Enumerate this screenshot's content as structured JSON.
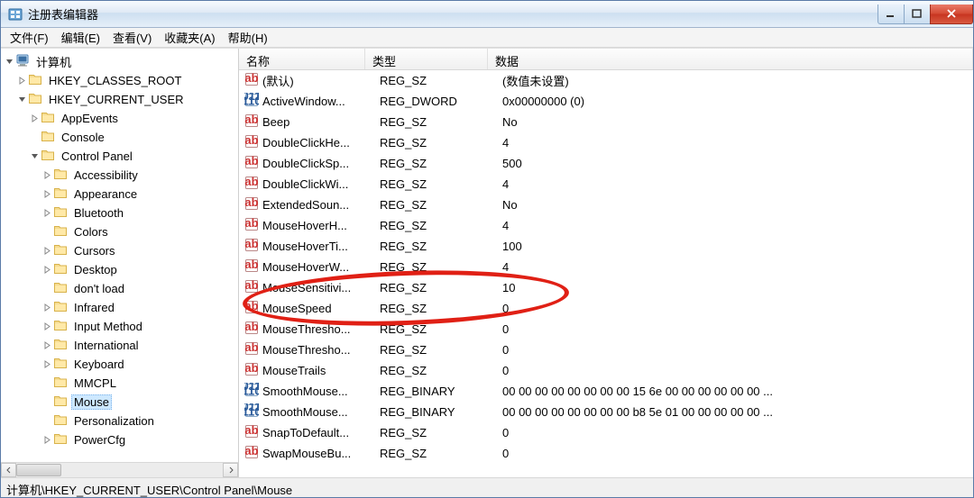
{
  "window": {
    "title": "注册表编辑器"
  },
  "menu": {
    "items": [
      "文件(F)",
      "编辑(E)",
      "查看(V)",
      "收藏夹(A)",
      "帮助(H)"
    ]
  },
  "tree": {
    "root": "计算机",
    "hkcr": "HKEY_CLASSES_ROOT",
    "hkcu": "HKEY_CURRENT_USER",
    "appevents": "AppEvents",
    "console": "Console",
    "controlpanel": "Control Panel",
    "cp_children": [
      "Accessibility",
      "Appearance",
      "Bluetooth",
      "Colors",
      "Cursors",
      "Desktop",
      "don't load",
      "Infrared",
      "Input Method",
      "International",
      "Keyboard",
      "MMCPL",
      "Mouse",
      "Personalization",
      "PowerCfg"
    ],
    "selected": "Mouse"
  },
  "columns": {
    "name": "名称",
    "type": "类型",
    "data": "数据"
  },
  "values": [
    {
      "icon": "sz",
      "name": "(默认)",
      "type": "REG_SZ",
      "data": "(数值未设置)"
    },
    {
      "icon": "bin",
      "name": "ActiveWindow...",
      "type": "REG_DWORD",
      "data": "0x00000000 (0)"
    },
    {
      "icon": "sz",
      "name": "Beep",
      "type": "REG_SZ",
      "data": "No"
    },
    {
      "icon": "sz",
      "name": "DoubleClickHe...",
      "type": "REG_SZ",
      "data": "4"
    },
    {
      "icon": "sz",
      "name": "DoubleClickSp...",
      "type": "REG_SZ",
      "data": "500"
    },
    {
      "icon": "sz",
      "name": "DoubleClickWi...",
      "type": "REG_SZ",
      "data": "4"
    },
    {
      "icon": "sz",
      "name": "ExtendedSoun...",
      "type": "REG_SZ",
      "data": "No"
    },
    {
      "icon": "sz",
      "name": "MouseHoverH...",
      "type": "REG_SZ",
      "data": "4"
    },
    {
      "icon": "sz",
      "name": "MouseHoverTi...",
      "type": "REG_SZ",
      "data": "100"
    },
    {
      "icon": "sz",
      "name": "MouseHoverW...",
      "type": "REG_SZ",
      "data": "4"
    },
    {
      "icon": "sz",
      "name": "MouseSensitivi...",
      "type": "REG_SZ",
      "data": "10"
    },
    {
      "icon": "sz",
      "name": "MouseSpeed",
      "type": "REG_SZ",
      "data": "0"
    },
    {
      "icon": "sz",
      "name": "MouseThresho...",
      "type": "REG_SZ",
      "data": "0"
    },
    {
      "icon": "sz",
      "name": "MouseThresho...",
      "type": "REG_SZ",
      "data": "0"
    },
    {
      "icon": "sz",
      "name": "MouseTrails",
      "type": "REG_SZ",
      "data": "0"
    },
    {
      "icon": "bin",
      "name": "SmoothMouse...",
      "type": "REG_BINARY",
      "data": "00 00 00 00 00 00 00 00 15 6e 00 00 00 00 00 00 ..."
    },
    {
      "icon": "bin",
      "name": "SmoothMouse...",
      "type": "REG_BINARY",
      "data": "00 00 00 00 00 00 00 00 b8 5e 01 00 00 00 00 00 ..."
    },
    {
      "icon": "sz",
      "name": "SnapToDefault...",
      "type": "REG_SZ",
      "data": "0"
    },
    {
      "icon": "sz",
      "name": "SwapMouseBu...",
      "type": "REG_SZ",
      "data": "0"
    }
  ],
  "statusbar": "计算机\\HKEY_CURRENT_USER\\Control Panel\\Mouse"
}
